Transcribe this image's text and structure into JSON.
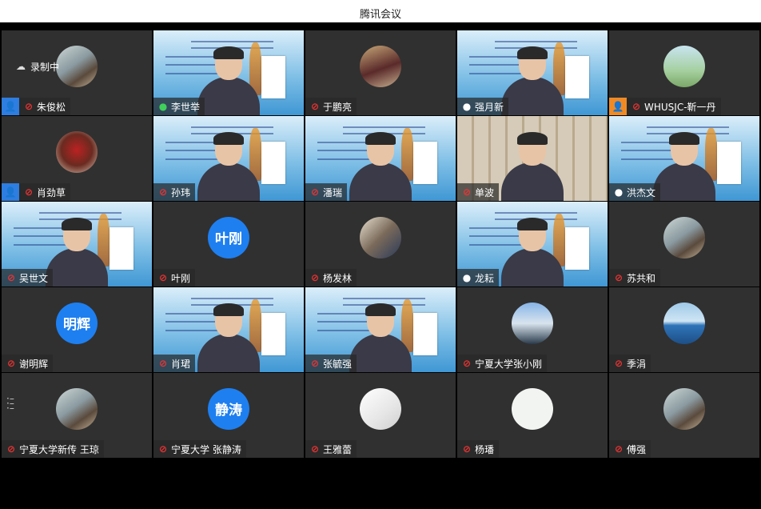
{
  "window": {
    "title": "腾讯会议"
  },
  "recording": {
    "label": "录制中"
  },
  "participants": [
    {
      "name": "朱俊松",
      "tile": "photo",
      "host": "blue",
      "mic": "off"
    },
    {
      "name": "李世举",
      "tile": "slide",
      "mic": "speaking",
      "active": true
    },
    {
      "name": "于鹏亮",
      "tile": "plum",
      "mic": "off"
    },
    {
      "name": "强月新",
      "tile": "slide",
      "mic": "on"
    },
    {
      "name": "WHUSJC-靳一丹",
      "tile": "green",
      "host": "orange",
      "mic": "off"
    },
    {
      "name": "肖劲草",
      "tile": "red",
      "host": "blue",
      "mic": "off"
    },
    {
      "name": "孙玮",
      "tile": "slide",
      "mic": "off"
    },
    {
      "name": "潘瑞",
      "tile": "slide",
      "mic": "off"
    },
    {
      "name": "单波",
      "tile": "bookshelf",
      "mic": "off"
    },
    {
      "name": "洪杰文",
      "tile": "slide",
      "mic": "on"
    },
    {
      "name": "吴世文",
      "tile": "slide",
      "mic": "off"
    },
    {
      "name": "叶刚",
      "tile": "text",
      "avatar_text": "叶刚",
      "mic": "off"
    },
    {
      "name": "杨发林",
      "tile": "room",
      "mic": "off"
    },
    {
      "name": "龙耘",
      "tile": "slide",
      "mic": "on"
    },
    {
      "name": "苏共和",
      "tile": "photo",
      "mic": "off"
    },
    {
      "name": "谢明辉",
      "tile": "text",
      "avatar_text": "明辉",
      "mic": "off"
    },
    {
      "name": "肖珺",
      "tile": "slide",
      "mic": "off"
    },
    {
      "name": "张毓强",
      "tile": "slide",
      "mic": "off"
    },
    {
      "name": "宁夏大学张小刚",
      "tile": "city",
      "mic": "off"
    },
    {
      "name": "季涓",
      "tile": "sea",
      "mic": "off"
    },
    {
      "name": "宁夏大学新传 王琼",
      "tile": "photo",
      "mic": "off"
    },
    {
      "name": "宁夏大学 张静涛",
      "tile": "text",
      "avatar_text": "静涛",
      "mic": "off"
    },
    {
      "name": "王雅蕾",
      "tile": "paper",
      "mic": "off"
    },
    {
      "name": "杨璠",
      "tile": "white",
      "mic": "off"
    },
    {
      "name": "傅强",
      "tile": "photo",
      "mic": "off"
    }
  ],
  "icons": {
    "mic_off": "mic-off-icon",
    "mic_on": "mic-icon",
    "host": "user-icon",
    "cloud": "cloud-icon",
    "handle": "drag-handle-icon"
  },
  "colors": {
    "speaking": "#3fcf5a",
    "avatar_blue": "#1e7ff0",
    "host_blue": "#2e7de0",
    "host_orange": "#f08a24",
    "tile_bg": "#303030"
  }
}
